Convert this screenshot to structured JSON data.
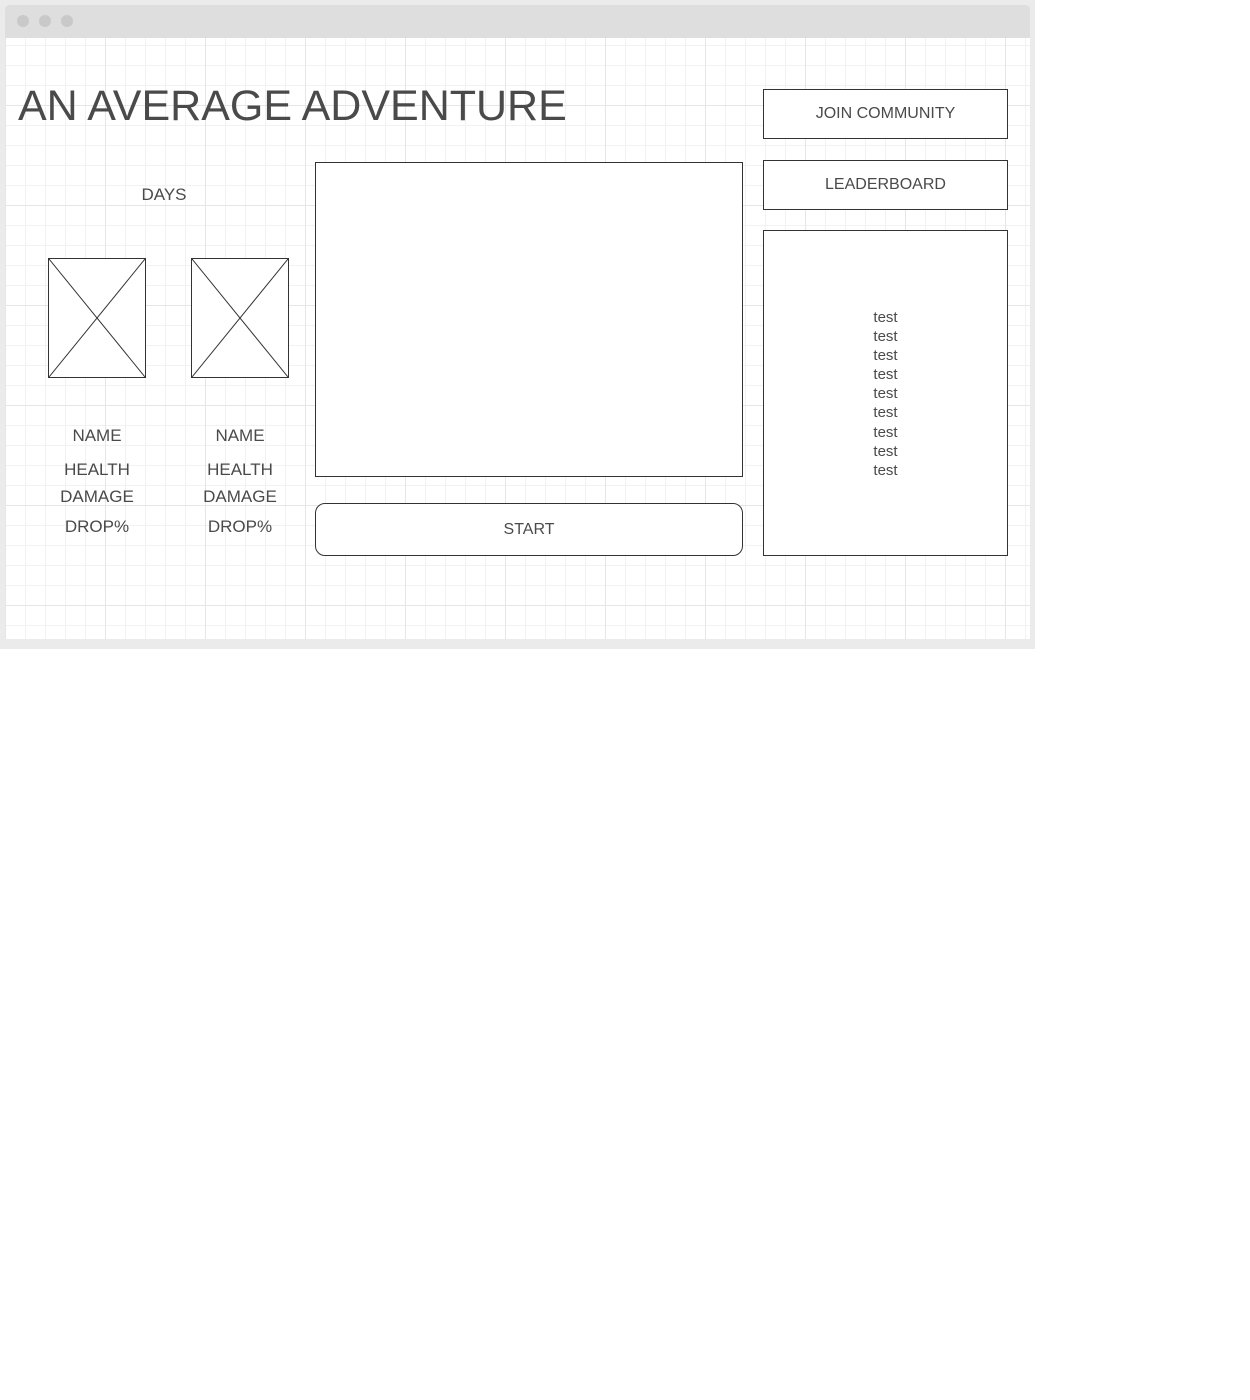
{
  "title": "AN AVERAGE ADVENTURE",
  "days_label": "DAYS",
  "characters": [
    {
      "name": "NAME",
      "health": "HEALTH",
      "damage": "DAMAGE",
      "drop": "DROP%"
    },
    {
      "name": "NAME",
      "health": "HEALTH",
      "damage": "DAMAGE",
      "drop": "DROP%"
    }
  ],
  "buttons": {
    "join_community": "JOIN COMMUNITY",
    "leaderboard": "LEADERBOARD",
    "start": "START"
  },
  "leaderboard_entries": [
    "test",
    "test",
    "test",
    "test",
    "test",
    "test",
    "test",
    "test",
    "test"
  ]
}
